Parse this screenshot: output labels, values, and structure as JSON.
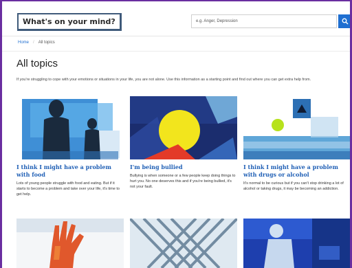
{
  "header": {
    "logo_text": "What's on your mind?",
    "search_placeholder": "e.g. Anger, Depression"
  },
  "breadcrumb": {
    "home": "Home",
    "current": "All topics"
  },
  "page": {
    "title": "All topics",
    "intro": "If you're struggling to cope with your emotions or situations in your life, you are not alone. Use this information as a starting point and find out where you can get extra help from."
  },
  "cards": [
    {
      "title": "I think I might have a problem with food",
      "description": "Lots of young people struggle with food and eating. But if it starts to become a problem and take over your life, it's time to get help."
    },
    {
      "title": "I'm being bullied",
      "description": "Bullying is when someone or a few people keep doing things to hurt you. No one deserves this and if you're being bullied, it's not your fault."
    },
    {
      "title": "I think I might have a problem with drugs or alcohol",
      "description": "It's normal to be curious but if you can't stop drinking a lot of alcohol or taking drugs, it may be becoming an addiction."
    }
  ],
  "colors": {
    "accent": "#1f6fd1",
    "frame": "#6a2ea0",
    "link": "#1f5fb5"
  }
}
